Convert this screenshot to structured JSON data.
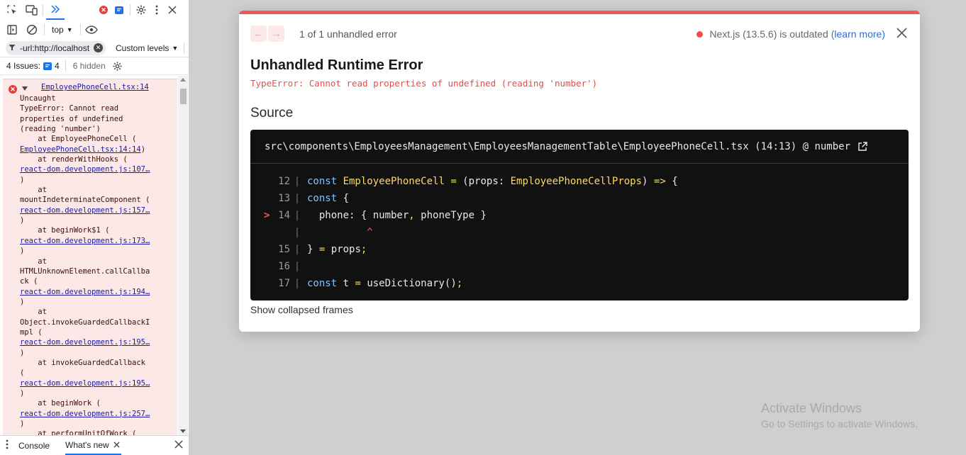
{
  "devtools": {
    "context": "top",
    "filter_value": "-url:http://localhost",
    "levels": "Custom levels",
    "issues_label": "4 Issues:",
    "issues_count": "4",
    "hidden": "6 hidden",
    "error": {
      "source": "EmployeePhoneCell.tsx:14",
      "lines": [
        {
          "t": "Uncaught"
        },
        {
          "t": "TypeError: Cannot read"
        },
        {
          "t": "properties of undefined"
        },
        {
          "t": "(reading 'number')"
        },
        {
          "t": "    at EmployeePhoneCell ("
        },
        {
          "t": "EmployeePhoneCell.tsx:14:14",
          "link": true,
          "suffix": ")"
        },
        {
          "t": "    at renderWithHooks ("
        },
        {
          "t": "react-dom.development.js:107…",
          "link": true
        },
        {
          "t": ")"
        },
        {
          "t": "    at"
        },
        {
          "t": "mountIndeterminateComponent ("
        },
        {
          "t": "react-dom.development.js:157…",
          "link": true
        },
        {
          "t": ")"
        },
        {
          "t": "    at beginWork$1 ("
        },
        {
          "t": "react-dom.development.js:173…",
          "link": true
        },
        {
          "t": ")"
        },
        {
          "t": "    at"
        },
        {
          "t": "HTMLUnknownElement.callCallba"
        },
        {
          "t": "ck ("
        },
        {
          "t": "react-dom.development.js:194…",
          "link": true
        },
        {
          "t": ")"
        },
        {
          "t": "    at"
        },
        {
          "t": "Object.invokeGuardedCallbackI"
        },
        {
          "t": "mpl ("
        },
        {
          "t": "react-dom.development.js:195…",
          "link": true
        },
        {
          "t": ")"
        },
        {
          "t": "    at invokeGuardedCallback"
        },
        {
          "t": "("
        },
        {
          "t": "react-dom.development.js:195…",
          "link": true
        },
        {
          "t": ")"
        },
        {
          "t": "    at beginWork ("
        },
        {
          "t": "react-dom.development.js:257…",
          "link": true
        },
        {
          "t": ")"
        },
        {
          "t": "    at performUnitOfWork ("
        }
      ]
    },
    "drawer": {
      "console_tab": "Console",
      "whatsnew_tab": "What's new"
    }
  },
  "overlay": {
    "error_count": "1 of 1 unhandled error",
    "outdated_text": "Next.js (13.5.6) is outdated",
    "learn_more": "(learn more)",
    "title": "Unhandled Runtime Error",
    "subtitle": "TypeError: Cannot read properties of undefined (reading 'number')",
    "source_heading": "Source",
    "file_path": "src\\components\\EmployeesManagement\\EmployeesManagementTable\\EmployeePhoneCell.tsx (14:13) @ number",
    "code_lines": [
      {
        "num": "12",
        "marker": "",
        "tokens": [
          [
            "kw",
            "const "
          ],
          [
            "fn",
            "EmployeePhoneCell"
          ],
          [
            "pr",
            " "
          ],
          [
            "op",
            "="
          ],
          [
            "pr",
            " (props: "
          ],
          [
            "ty",
            "EmployeePhoneCellProps"
          ],
          [
            "pr",
            ") "
          ],
          [
            "op",
            "=>"
          ],
          [
            "pr",
            " {"
          ]
        ]
      },
      {
        "num": "13",
        "marker": "",
        "tokens": [
          [
            "kw",
            "const"
          ],
          [
            "pr",
            " {"
          ]
        ]
      },
      {
        "num": "14",
        "marker": ">",
        "tokens": [
          [
            "pr",
            "  phone: { number"
          ],
          [
            "op",
            ","
          ],
          [
            "pr",
            " phoneType }"
          ]
        ]
      },
      {
        "num": "",
        "marker": "",
        "tokens": [
          [
            "caret",
            "          ^"
          ]
        ]
      },
      {
        "num": "15",
        "marker": "",
        "tokens": [
          [
            "pr",
            "} "
          ],
          [
            "op",
            "="
          ],
          [
            "pr",
            " props"
          ],
          [
            "op",
            ";"
          ]
        ]
      },
      {
        "num": "16",
        "marker": "",
        "tokens": []
      },
      {
        "num": "17",
        "marker": "",
        "tokens": [
          [
            "kw",
            "const"
          ],
          [
            "pr",
            " t "
          ],
          [
            "op",
            "="
          ],
          [
            "pr",
            " useDictionary()"
          ],
          [
            "op",
            ";"
          ]
        ]
      }
    ],
    "show_frames": "Show collapsed frames"
  },
  "watermark": {
    "line1": "Activate Windows",
    "line2": "Go to Settings to activate Windows."
  },
  "colors": {
    "accent": "#1a73e8",
    "error_red": "#f25656",
    "code_bg": "#111111"
  }
}
